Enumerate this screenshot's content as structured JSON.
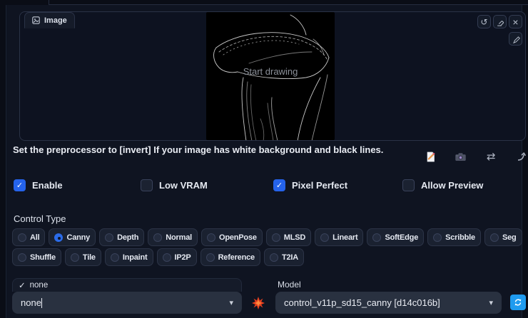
{
  "glyphs": {
    "check": "✓",
    "caret": "▾",
    "undo": "↺",
    "close": "×",
    "swap": "⇄"
  },
  "image_panel": {
    "tab_label": "Image",
    "placeholder": "Start drawing",
    "toolbar_icons": [
      "undo-icon",
      "eraser-icon",
      "close-icon",
      "pen-icon"
    ]
  },
  "note": {
    "text": "Set the preprocessor to [invert] If your image has white background and black lines.",
    "icons": [
      "new-canvas-icon",
      "webcam-icon",
      "mirror-webcam-icon",
      "send-dimensions-icon"
    ]
  },
  "checkboxes": [
    {
      "label": "Enable",
      "checked": true
    },
    {
      "label": "Low VRAM",
      "checked": false
    },
    {
      "label": "Pixel Perfect",
      "checked": true
    },
    {
      "label": "Allow Preview",
      "checked": false
    }
  ],
  "control_type": {
    "label": "Control Type",
    "selected": "Canny",
    "row1": [
      "All",
      "Canny",
      "Depth",
      "Normal",
      "OpenPose",
      "MLSD",
      "Lineart",
      "SoftEdge",
      "Scribble",
      "Seg"
    ],
    "row2": [
      "Shuffle",
      "Tile",
      "Inpaint",
      "IP2P",
      "Reference",
      "T2IA"
    ]
  },
  "preprocessor": {
    "status_label": "none",
    "value": "none"
  },
  "model": {
    "label": "Model",
    "value": "control_v11p_sd15_canny [d14c016b]"
  },
  "colors": {
    "accent": "#2563eb",
    "radio_checked": "#2b6be8",
    "refresh_button": "#1f9bef",
    "panel_bg": "#0f1421"
  }
}
